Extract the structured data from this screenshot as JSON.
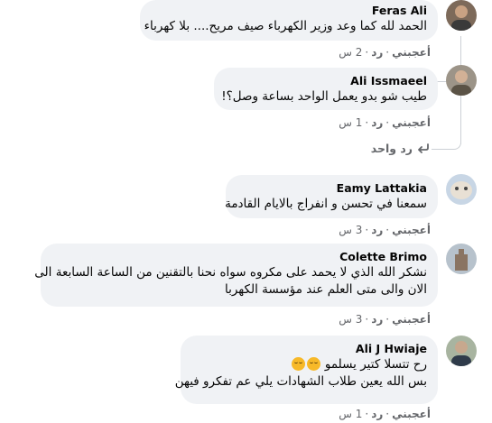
{
  "comments": [
    {
      "author": "Feras Ali",
      "text": [
        "الحمد لله كما وعد وزير الكهرباء صيف مريح.... بلا كهرباء"
      ],
      "like_label": "أعجبني",
      "reply_label": "رد",
      "time": "2 س"
    },
    {
      "author": "Ali Issmaeel",
      "text": [
        "طيب شو بدو يعمل الواحد بساعة وصل؟!"
      ],
      "like_label": "أعجبني",
      "reply_label": "رد",
      "time": "1 س"
    },
    {
      "author": "Eamy Lattakia",
      "text": [
        "سمعنا في تحسن و انفراج بالايام القادمة"
      ],
      "like_label": "أعجبني",
      "reply_label": "رد",
      "time": "3 س"
    },
    {
      "author": "Colette Brimo",
      "text": [
        "نشكر الله الذي لا يحمد على مكروه سواه نحنا بالتقنين من الساعة السابعة الى",
        "الان والى متى العلم عند مؤسسة الكهربا"
      ],
      "like_label": "أعجبني",
      "reply_label": "رد",
      "time": "3 س"
    },
    {
      "author": "Ali J Hwiaje",
      "text": [
        "رح تتسلا كتير يسلمو",
        "بس الله يعين طلاب الشهادات يلي عم تفكرو فيهن"
      ],
      "like_label": "أعجبني",
      "reply_label": "رد",
      "time": "1 س"
    }
  ],
  "thread": {
    "reply_link_label": "رد واحد",
    "reply_icon": "reply-arrow-icon"
  },
  "colors": {
    "bubble": "#f0f2f5",
    "meta_text": "#65676b",
    "thread_line": "#ccd0d5"
  }
}
